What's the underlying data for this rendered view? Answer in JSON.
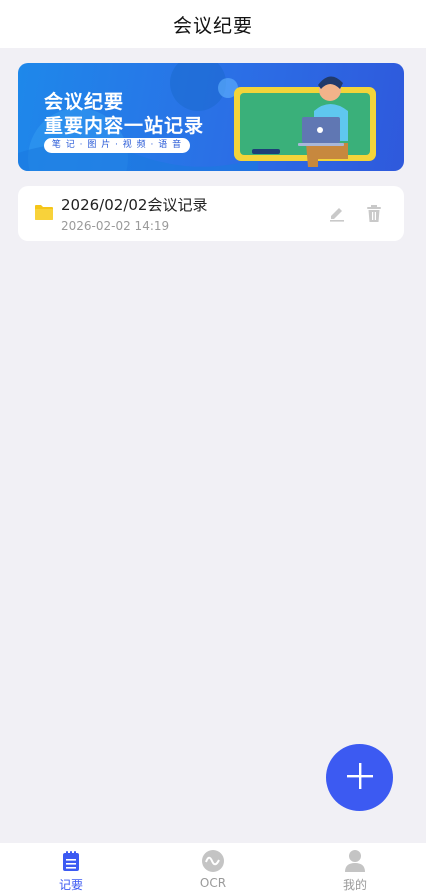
{
  "header": {
    "title": "会议纪要"
  },
  "banner": {
    "line1": "会议纪要",
    "line2": "重要内容一站记录",
    "tagline": "笔 记 · 图 片 · 视 频 · 语 音"
  },
  "records": [
    {
      "title": "2026/02/02会议记录",
      "time": "2026-02-02 14:19",
      "icon": "folder-icon"
    }
  ],
  "fab": {
    "icon": "plus-icon",
    "color": "#3c5af2"
  },
  "tabbar": {
    "tabs": [
      {
        "label": "记要",
        "icon": "notes-icon",
        "active": true
      },
      {
        "label": "OCR",
        "icon": "ocr-icon",
        "active": false
      },
      {
        "label": "我的",
        "icon": "user-icon",
        "active": false
      }
    ]
  },
  "colors": {
    "accent": "#3c5af2",
    "background": "#f1f0f5",
    "folder": "#f5c518"
  }
}
